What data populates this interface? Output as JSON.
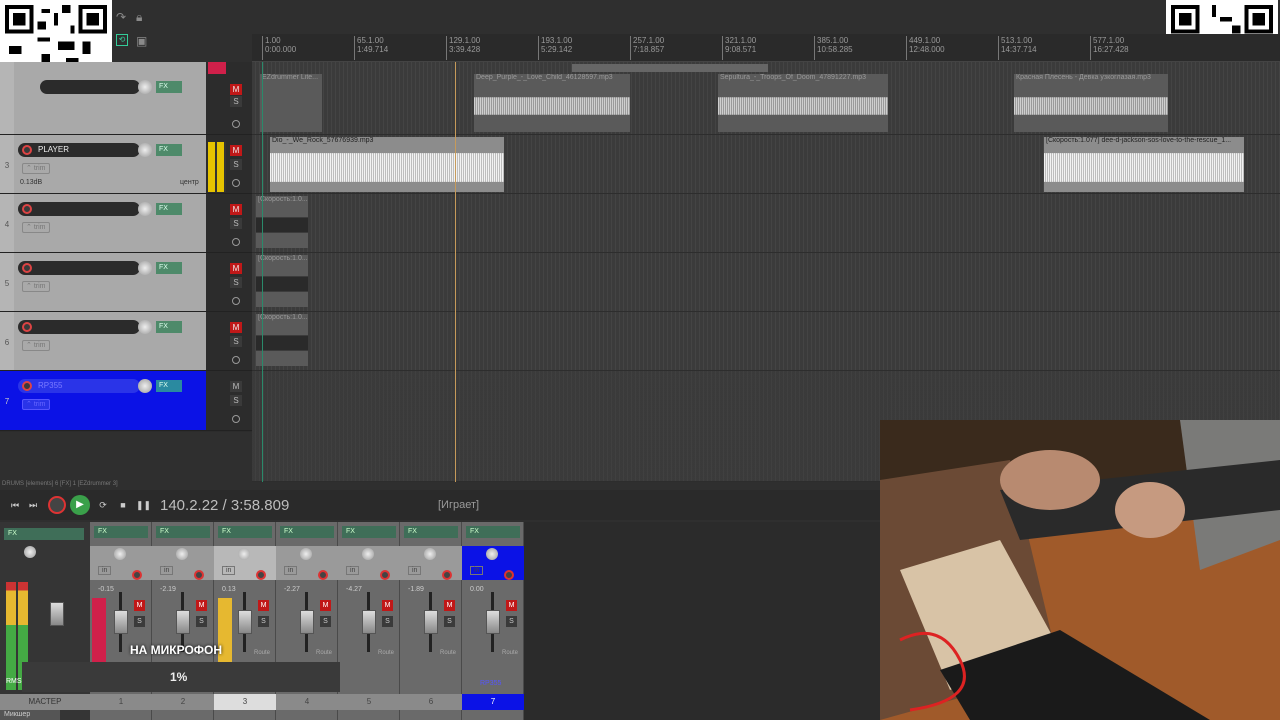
{
  "ruler": {
    "ticks": [
      {
        "bar": "1.00",
        "time": "0:00.000"
      },
      {
        "bar": "65.1.00",
        "time": "1:49.714"
      },
      {
        "bar": "129.1.00",
        "time": "3:39.428"
      },
      {
        "bar": "193.1.00",
        "time": "5:29.142"
      },
      {
        "bar": "257.1.00",
        "time": "7:18.857"
      },
      {
        "bar": "321.1.00",
        "time": "9:08.571"
      },
      {
        "bar": "385.1.00",
        "time": "10:58.285"
      },
      {
        "bar": "449.1.00",
        "time": "12:48.000"
      },
      {
        "bar": "513.1.00",
        "time": "14:37.714"
      },
      {
        "bar": "577.1.00",
        "time": "16:27.428"
      }
    ]
  },
  "tracks": [
    {
      "number": "",
      "name": "",
      "vol": "",
      "pan": "",
      "fx": "FX"
    },
    {
      "number": "3",
      "name": "PLAYER",
      "vol": "0.13dB",
      "pan": "центр",
      "fx": "FX",
      "trim": "trim"
    },
    {
      "number": "4",
      "name": "",
      "fx": "FX",
      "trim": "trim"
    },
    {
      "number": "5",
      "name": "",
      "fx": "FX",
      "trim": "trim"
    },
    {
      "number": "6",
      "name": "",
      "fx": "FX",
      "trim": "trim"
    },
    {
      "number": "7",
      "name": "RP355",
      "fx": "FX",
      "trim": "trim"
    }
  ],
  "buttons": {
    "mute": "M",
    "solo": "S"
  },
  "items": {
    "lane1": [
      "EZdrummer Lite...",
      "Deep_Purple_-_Love_Child_46128597.mp3",
      "Sepultura_-_Troops_Of_Doom_47891227.mp3",
      "Красная Плесень - Девка узкоглазая.mp3"
    ],
    "lane2": [
      "Dio_-_We_Rock_57676939.mp3",
      "[Скорость:1.077] dee-d-jackson-sos-love-to-the-rescue_1..."
    ],
    "lane_small": "[Скорость:1.0..."
  },
  "status_line": "DRUMS [elements] 6 [FX] 1 [EZdrummer 3]",
  "transport": {
    "time": "140.2.22 / 3:58.809",
    "state": "[Играет]"
  },
  "mixer": {
    "master_label": "МАСТЕР",
    "master_rms": "RMS",
    "strips": [
      {
        "number": "1",
        "vol": "-0.15"
      },
      {
        "number": "2",
        "vol": "-2.19"
      },
      {
        "number": "3",
        "vol": "0.13"
      },
      {
        "number": "4",
        "vol": "-2.27"
      },
      {
        "number": "5",
        "vol": "-4.27"
      },
      {
        "number": "6",
        "vol": "-1.89"
      },
      {
        "number": "7",
        "vol": "0.00",
        "name": "RP355"
      }
    ],
    "in_label": "in",
    "route_label": "Route",
    "fx_label": "FX"
  },
  "overlay": {
    "caption": "НА МИКРОФОН",
    "percent": "1%"
  },
  "mixer_tab": "Микшер",
  "colors": {
    "selected_track": "#0b12e6",
    "mute_red": "#c01818",
    "play_green": "#3aa04a",
    "playhead": "#c69a5a"
  }
}
